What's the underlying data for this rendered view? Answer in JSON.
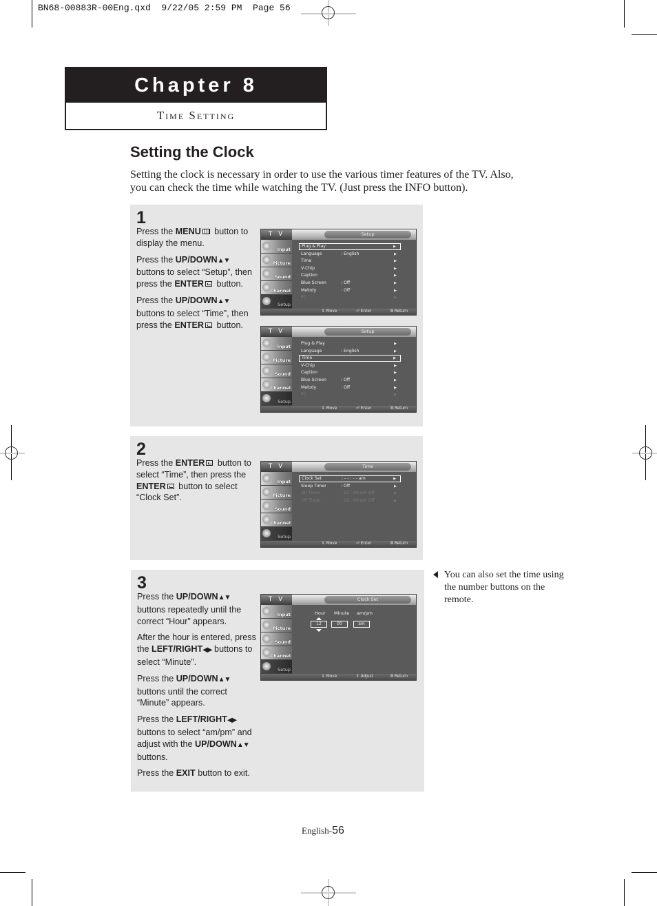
{
  "slug": "BN68-00883R-00Eng.qxd  9/22/05 2:59 PM  Page 56",
  "chapter": {
    "title": "Chapter 8",
    "subtitle": "Time Setting"
  },
  "section": {
    "title": "Setting the Clock",
    "intro": "Setting the clock is necessary in order to use the various timer features of the TV. Also, you can check the time while watching the TV. (Just press the INFO button)."
  },
  "icons": {
    "menu": "menu-button-icon",
    "enter": "enter-button-icon",
    "updown": "▲▼",
    "leftright": "◀▶"
  },
  "tv_common": {
    "logo": "T V",
    "sidebar": [
      "Input",
      "Picture",
      "Sound",
      "Channel",
      "Setup"
    ],
    "hints": {
      "move": "Move",
      "enter": "Enter",
      "adjust": "Adjust",
      "return": "Return"
    }
  },
  "steps": [
    {
      "number": "1",
      "paragraphs": [
        {
          "pre": "Press the ",
          "bold": "MENU",
          "icon": "menu",
          "post": " button to display the menu."
        },
        {
          "pre": "Press the ",
          "bold": "UP/DOWN",
          "icon": "updown",
          "mid": " buttons to select “Setup”, then press the ",
          "bold2": "ENTER",
          "icon2": "enter",
          "post": " button."
        },
        {
          "pre": "Press the ",
          "bold": "UP/DOWN",
          "icon": "updown",
          "mid": " buttons to select “Time”, then press the ",
          "bold2": "ENTER",
          "icon2": "enter",
          "post": " button."
        }
      ],
      "screens": [
        {
          "title": "Setup",
          "rows": [
            {
              "label": "Plug & Play",
              "value": "",
              "highlight": true,
              "dim": false
            },
            {
              "label": "Language",
              "value": ": English",
              "highlight": false,
              "dim": false
            },
            {
              "label": "Time",
              "value": "",
              "highlight": false,
              "dim": false
            },
            {
              "label": "V-Chip",
              "value": "",
              "highlight": false,
              "dim": false
            },
            {
              "label": "Caption",
              "value": "",
              "highlight": false,
              "dim": false
            },
            {
              "label": "Blue Screen",
              "value": ": Off",
              "highlight": false,
              "dim": false
            },
            {
              "label": "Melody",
              "value": ": Off",
              "highlight": false,
              "dim": false
            },
            {
              "label": "PC",
              "value": "",
              "highlight": false,
              "dim": true
            }
          ],
          "hints": [
            "Move",
            "Enter",
            "Return"
          ]
        },
        {
          "title": "Setup",
          "rows": [
            {
              "label": "Plug & Play",
              "value": "",
              "highlight": false,
              "dim": false
            },
            {
              "label": "Language",
              "value": ": English",
              "highlight": false,
              "dim": false
            },
            {
              "label": "Time",
              "value": "",
              "highlight": true,
              "dim": false
            },
            {
              "label": "V-Chip",
              "value": "",
              "highlight": false,
              "dim": false
            },
            {
              "label": "Caption",
              "value": "",
              "highlight": false,
              "dim": false
            },
            {
              "label": "Blue Screen",
              "value": ": Off",
              "highlight": false,
              "dim": false
            },
            {
              "label": "Melody",
              "value": ": Off",
              "highlight": false,
              "dim": false
            },
            {
              "label": "PC",
              "value": "",
              "highlight": false,
              "dim": true
            }
          ],
          "hints": [
            "Move",
            "Enter",
            "Return"
          ]
        }
      ]
    },
    {
      "number": "2",
      "paragraphs": [
        {
          "pre": "Press the ",
          "bold": "ENTER",
          "icon": "enter",
          "mid": " button to select “Time”, then press the ",
          "bold2": "ENTER",
          "icon2": "enter",
          "post": " button to select “Clock Set”."
        }
      ],
      "screens": [
        {
          "title": "Time",
          "rows": [
            {
              "label": "Clock Set",
              "value": ": - - : - -  am",
              "highlight": true,
              "dim": false
            },
            {
              "label": "Sleep Timer",
              "value": ":          Off",
              "highlight": false,
              "dim": false
            },
            {
              "label": "On Timer",
              "value": ": 12 : 00  am Off",
              "highlight": false,
              "dim": true
            },
            {
              "label": "Off Timer",
              "value": ": 12 : 00  am Off",
              "highlight": false,
              "dim": true
            }
          ],
          "hints": [
            "Move",
            "Enter",
            "Return"
          ]
        }
      ]
    },
    {
      "number": "3",
      "paragraphs": [
        {
          "pre": "Press the ",
          "bold": "UP/DOWN",
          "icon": "updown",
          "post": " buttons repeatedly until the correct “Hour” appears."
        },
        {
          "pre": "After the hour is entered, press the ",
          "bold": "LEFT/RIGHT",
          "icon": "leftright",
          "post": " buttons to select “Minute”."
        },
        {
          "pre": "Press the ",
          "bold": "UP/DOWN",
          "icon": "updown",
          "post": " buttons until the correct “Minute” appears."
        },
        {
          "pre": "Press the ",
          "bold": "LEFT/RIGHT",
          "icon": "leftright",
          "mid": " buttons to select “am/pm” and adjust with the ",
          "bold2": "UP/DOWN",
          "icon2": "updown",
          "post": " buttons."
        },
        {
          "pre": "Press the ",
          "bold": "EXIT",
          "post": " button to exit."
        }
      ],
      "screens": [
        {
          "title": "Clock Set",
          "clock": {
            "headers": [
              "Hour",
              "Minute",
              "am/pm"
            ],
            "values": [
              "12",
              "00",
              "am"
            ]
          },
          "hints": [
            "Move",
            "Adjust",
            "Return"
          ]
        }
      ]
    }
  ],
  "side_note": "You can also set the time using the number buttons on the remote.",
  "footer": {
    "prefix": "English-",
    "page": "56"
  }
}
